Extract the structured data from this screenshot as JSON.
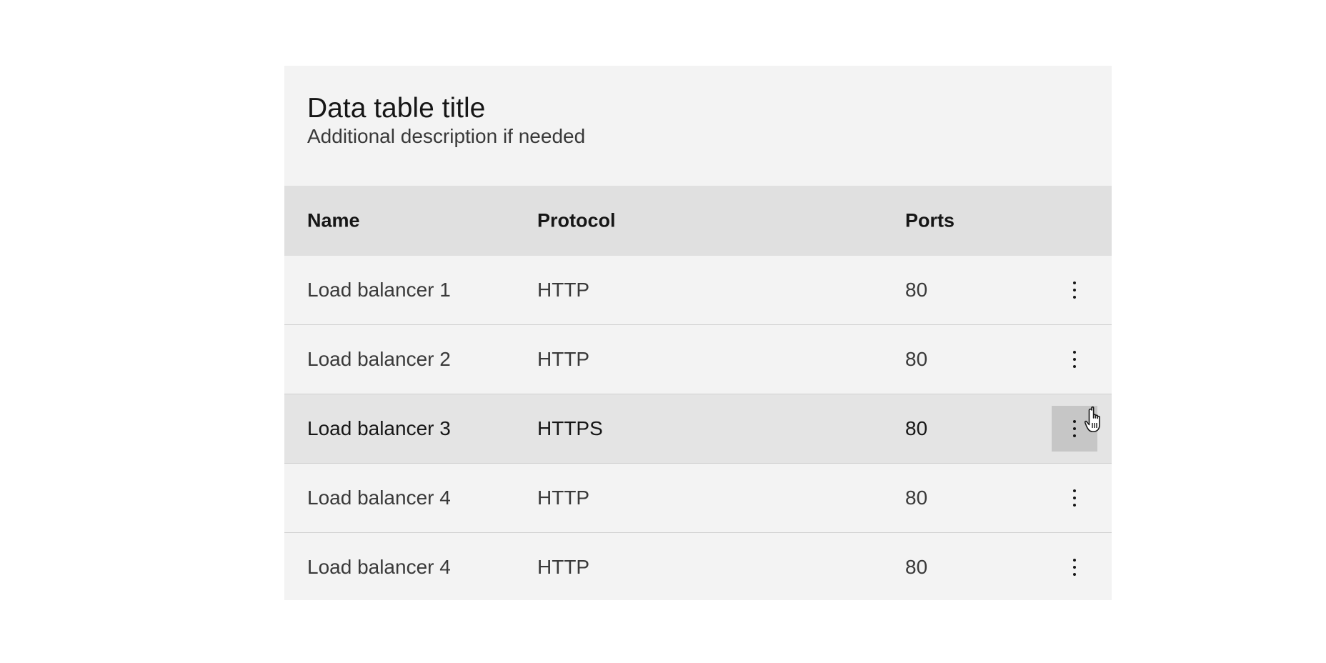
{
  "table": {
    "title": "Data table title",
    "description": "Additional description if needed",
    "columns": [
      "Name",
      "Protocol",
      "Ports"
    ],
    "rows": [
      {
        "name": "Load balancer 1",
        "protocol": "HTTP",
        "ports": "80"
      },
      {
        "name": "Load balancer 2",
        "protocol": "HTTP",
        "ports": "80"
      },
      {
        "name": "Load balancer 3",
        "protocol": "HTTPS",
        "ports": "80"
      },
      {
        "name": "Load balancer 4",
        "protocol": "HTTP",
        "ports": "80"
      },
      {
        "name": "Load balancer 4",
        "protocol": "HTTP",
        "ports": "80"
      }
    ],
    "hovered_row_index": 2,
    "row_action_icon": "overflow-menu-vertical-icon"
  },
  "cursor": {
    "icon": "hand-pointer-icon"
  },
  "colors": {
    "container_bg": "#f3f3f3",
    "header_bg": "#e0e0e0",
    "hover_row_bg": "#e4e4e4",
    "hover_button_bg": "#c6c6c6",
    "text_primary": "#161616",
    "text_secondary": "#393939"
  }
}
